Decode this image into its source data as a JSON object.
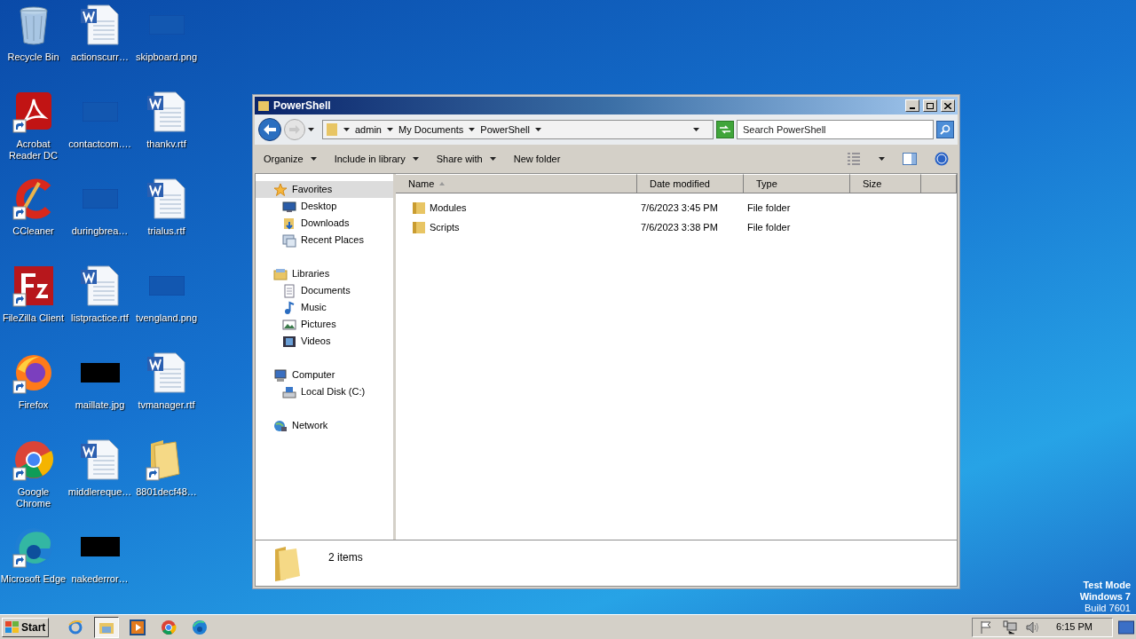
{
  "desktop_icons": [
    {
      "label": "Recycle Bin",
      "kind": "recycle",
      "shortcut": false
    },
    {
      "label": "Acrobat Reader DC",
      "kind": "pdf",
      "shortcut": true
    },
    {
      "label": "CCleaner",
      "kind": "ccleaner",
      "shortcut": true
    },
    {
      "label": "FileZilla Client",
      "kind": "filezilla",
      "shortcut": true
    },
    {
      "label": "Firefox",
      "kind": "firefox",
      "shortcut": true
    },
    {
      "label": "Google Chrome",
      "kind": "chrome",
      "shortcut": true
    },
    {
      "label": "Microsoft Edge",
      "kind": "edge",
      "shortcut": true
    },
    {
      "label": "actionscurr…",
      "kind": "word",
      "shortcut": false
    },
    {
      "label": "contactcom….",
      "kind": "png",
      "shortcut": false
    },
    {
      "label": "duringbrea…",
      "kind": "png",
      "shortcut": false
    },
    {
      "label": "listpractice.rtf",
      "kind": "word",
      "shortcut": false
    },
    {
      "label": "maillate.jpg",
      "kind": "jpg",
      "shortcut": false
    },
    {
      "label": "middlereque…",
      "kind": "word",
      "shortcut": false
    },
    {
      "label": "nakederror…",
      "kind": "jpg",
      "shortcut": false
    },
    {
      "label": "skipboard.png",
      "kind": "png",
      "shortcut": false
    },
    {
      "label": "thankv.rtf",
      "kind": "word",
      "shortcut": false
    },
    {
      "label": "trialus.rtf",
      "kind": "word",
      "shortcut": false
    },
    {
      "label": "tvengland.png",
      "kind": "png",
      "shortcut": false
    },
    {
      "label": "tvmanager.rtf",
      "kind": "word",
      "shortcut": false
    },
    {
      "label": "8801decf48…",
      "kind": "folder",
      "shortcut": true
    }
  ],
  "window": {
    "title": "PowerShell",
    "breadcrumb": [
      "admin",
      "My Documents",
      "PowerShell"
    ],
    "search": {
      "placeholder": "Search PowerShell"
    },
    "commands": [
      {
        "label": "Organize",
        "dropdown": true
      },
      {
        "label": "Include in library",
        "dropdown": true
      },
      {
        "label": "Share with",
        "dropdown": true
      },
      {
        "label": "New folder",
        "dropdown": false
      }
    ],
    "nav_tree": [
      {
        "label": "Favorites",
        "kind": "star",
        "selected": true,
        "children": [
          {
            "label": "Desktop",
            "kind": "desktop",
            "selected": false
          },
          {
            "label": "Downloads",
            "kind": "downloads",
            "selected": false
          },
          {
            "label": "Recent Places",
            "kind": "recent",
            "selected": false
          }
        ]
      },
      {
        "label": "Libraries",
        "kind": "library",
        "selected": false,
        "children": [
          {
            "label": "Documents",
            "kind": "documents",
            "selected": false
          },
          {
            "label": "Music",
            "kind": "music",
            "selected": false
          },
          {
            "label": "Pictures",
            "kind": "pictures",
            "selected": false
          },
          {
            "label": "Videos",
            "kind": "videos",
            "selected": false
          }
        ]
      },
      {
        "label": "Computer",
        "kind": "computer",
        "selected": false,
        "children": [
          {
            "label": "Local Disk (C:)",
            "kind": "disk",
            "selected": false
          }
        ]
      },
      {
        "label": "Network",
        "kind": "network",
        "selected": false
      }
    ],
    "columns": [
      {
        "label": "Name",
        "sorted": true
      },
      {
        "label": "Date modified",
        "sorted": false
      },
      {
        "label": "Type",
        "sorted": false
      },
      {
        "label": "Size",
        "sorted": false
      }
    ],
    "rows": [
      {
        "name": "Modules",
        "date": "7/6/2023 3:45 PM",
        "type": "File folder"
      },
      {
        "name": "Scripts",
        "date": "7/6/2023 3:38 PM",
        "type": "File folder"
      }
    ],
    "status": "2 items"
  },
  "test_mode": [
    "Test Mode",
    "Windows 7",
    "Build 7601"
  ],
  "taskbar": {
    "start": "Start",
    "apps": [
      {
        "kind": "ie",
        "active": false
      },
      {
        "kind": "explorer",
        "active": true
      },
      {
        "kind": "media",
        "active": false
      },
      {
        "kind": "chrome",
        "active": false
      },
      {
        "kind": "edge",
        "active": false
      }
    ],
    "clock": "6:15 PM"
  }
}
